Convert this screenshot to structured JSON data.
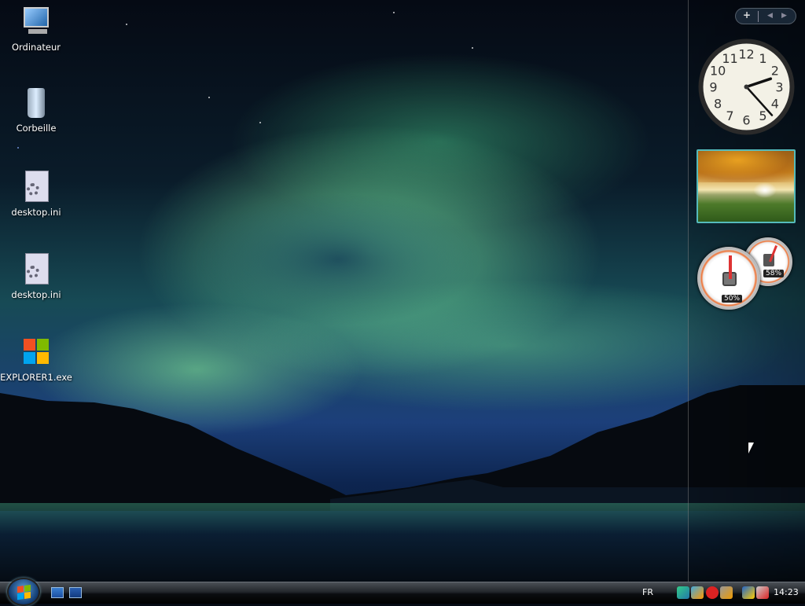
{
  "desktop": {
    "icons": [
      {
        "label": "Ordinateur",
        "icon": "computer-icon"
      },
      {
        "label": "Corbeille",
        "icon": "recycle-bin-icon"
      },
      {
        "label": "desktop.ini",
        "icon": "settings-file-icon"
      },
      {
        "label": "desktop.ini",
        "icon": "settings-file-icon"
      },
      {
        "label": "EXPLORER1.exe",
        "icon": "windows-logo-icon"
      }
    ]
  },
  "sidebar": {
    "add_label": "+",
    "prev_label": "◀",
    "next_label": "▶",
    "clock": {
      "hour": 14,
      "minute": 23,
      "numerals": [
        "12",
        "1",
        "2",
        "3",
        "4",
        "5",
        "6",
        "7",
        "8",
        "9",
        "10",
        "11"
      ]
    },
    "cpu_meter": {
      "cpu_percent": 50,
      "cpu_label": "50%",
      "memory_percent": 58,
      "memory_label": "58%"
    }
  },
  "taskbar": {
    "language": "FR",
    "time": "14:23"
  },
  "colors": {
    "accent": "#2b6fc4",
    "tray_alert": "#d22"
  }
}
